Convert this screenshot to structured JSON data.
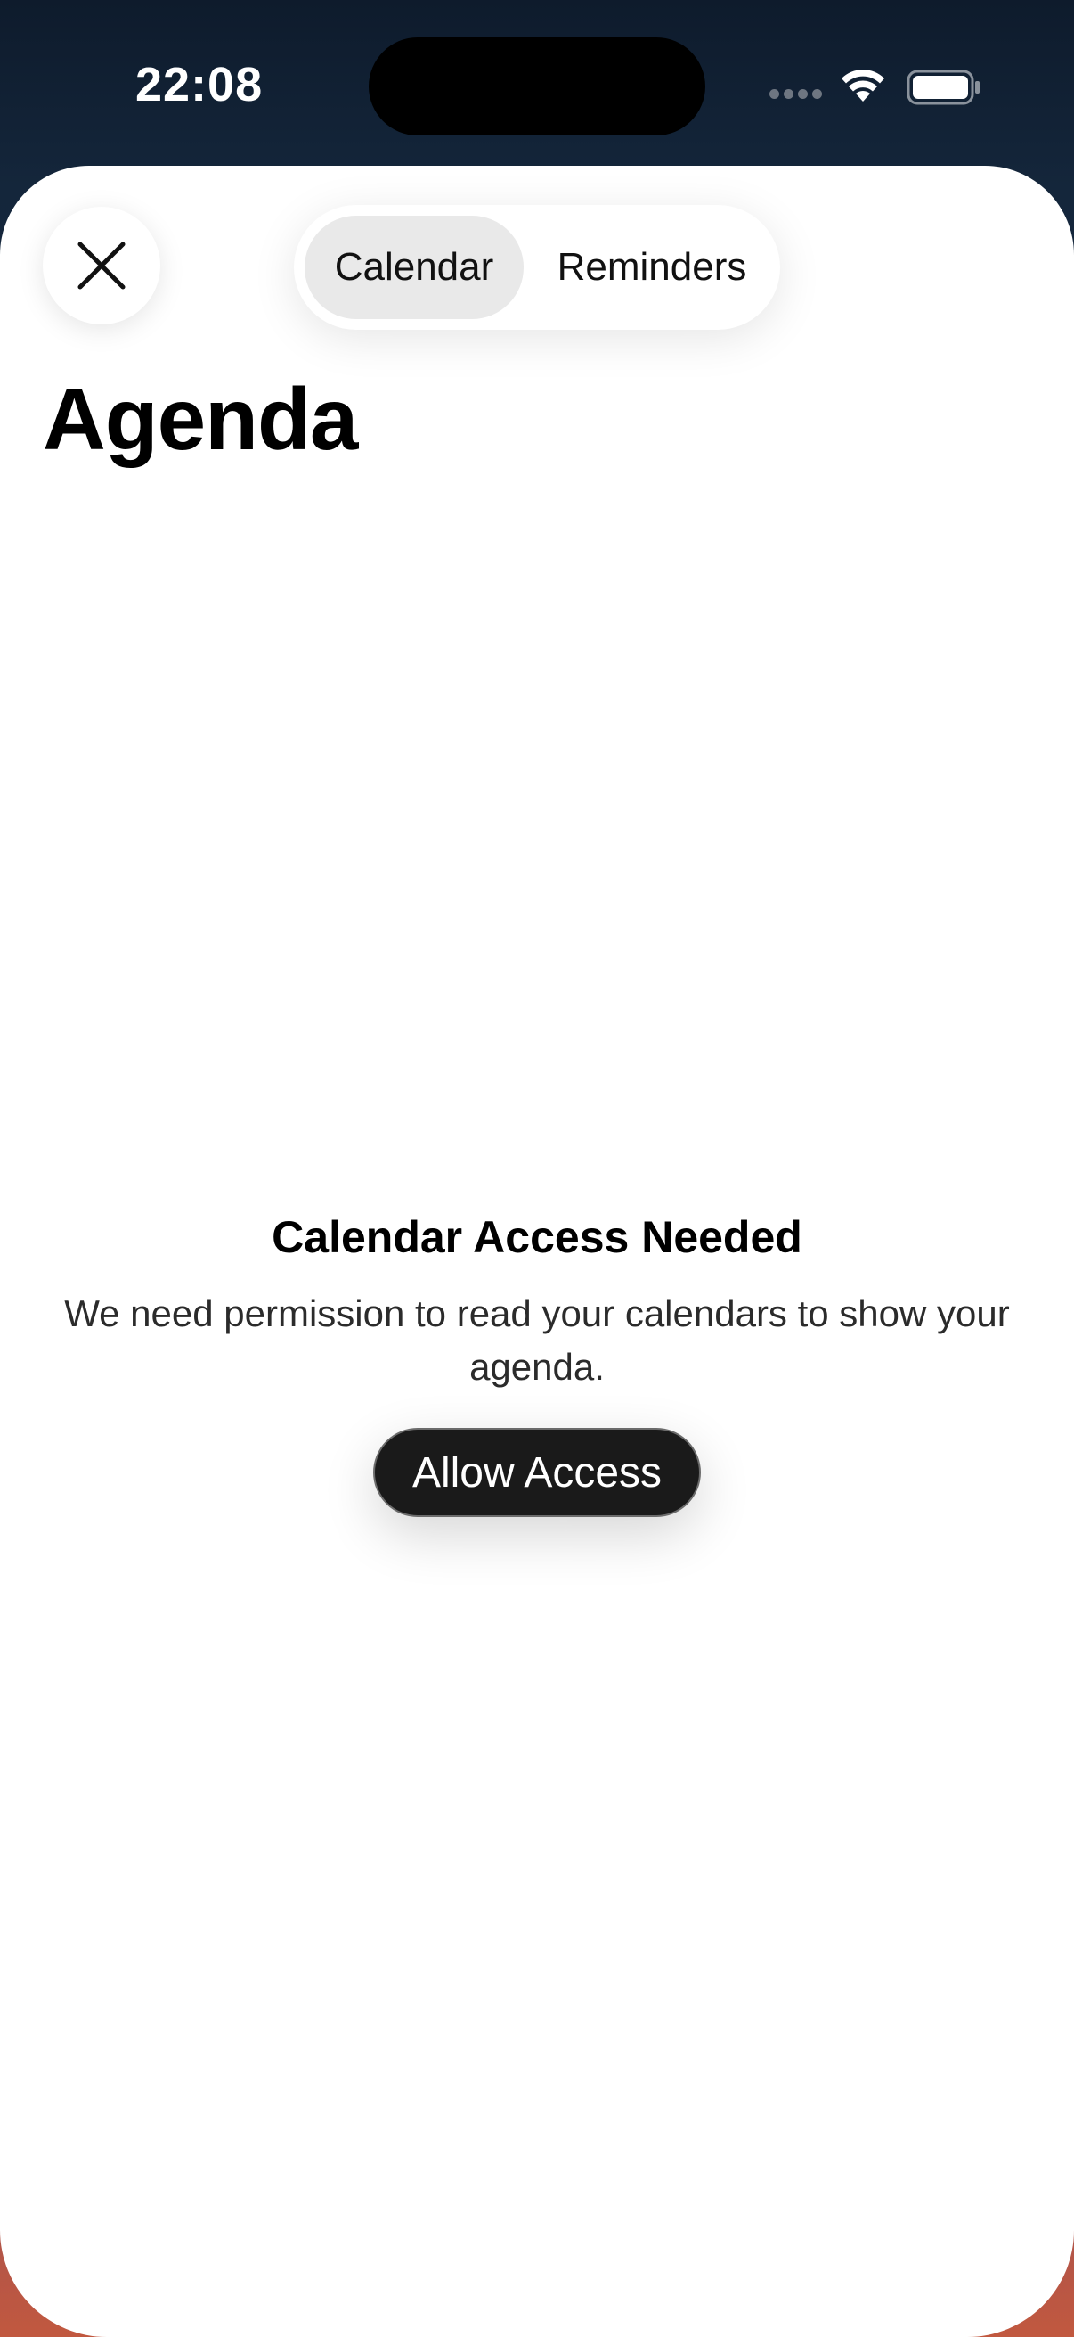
{
  "status_bar": {
    "time": "22:08",
    "signal_icon": "cellular-signal-icon",
    "wifi_icon": "wifi-icon",
    "battery_icon": "battery-icon"
  },
  "header": {
    "close_icon": "close-icon",
    "tabs": [
      {
        "label": "Calendar",
        "selected": true
      },
      {
        "label": "Reminders",
        "selected": false
      }
    ],
    "title": "Agenda"
  },
  "empty_state": {
    "title": "Calendar Access Needed",
    "message": "We need permission to read your calendars to show your agenda.",
    "button_label": "Allow Access"
  },
  "colors": {
    "button_background": "#1a1a1a",
    "selected_tab_background": "#e9e9e9",
    "sheet_background": "#ffffff"
  }
}
